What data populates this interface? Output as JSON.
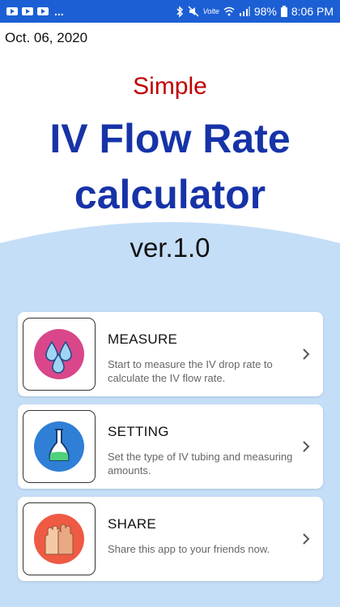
{
  "status_bar": {
    "dots": "...",
    "volte": "Volte",
    "battery": "98%",
    "time": "8:06 PM"
  },
  "date": "Oct. 06, 2020",
  "header": {
    "subtitle": "Simple",
    "title_line1": "IV Flow Rate",
    "title_line2": "calculator",
    "version": "ver.1.0"
  },
  "menu": [
    {
      "title": "MEASURE",
      "description": "Start to measure the IV drop rate to calculate the IV flow rate.",
      "icon": "water-drops-icon"
    },
    {
      "title": "SETTING",
      "description": "Set the type of IV tubing and measuring amounts.",
      "icon": "flask-icon"
    },
    {
      "title": "SHARE",
      "description": "Share this app to your friends now.",
      "icon": "hands-icon"
    }
  ],
  "colors": {
    "status_bar": "#1c5fd4",
    "title": "#1733a8",
    "subtitle": "#c00000",
    "background_wave": "#c5def7"
  }
}
